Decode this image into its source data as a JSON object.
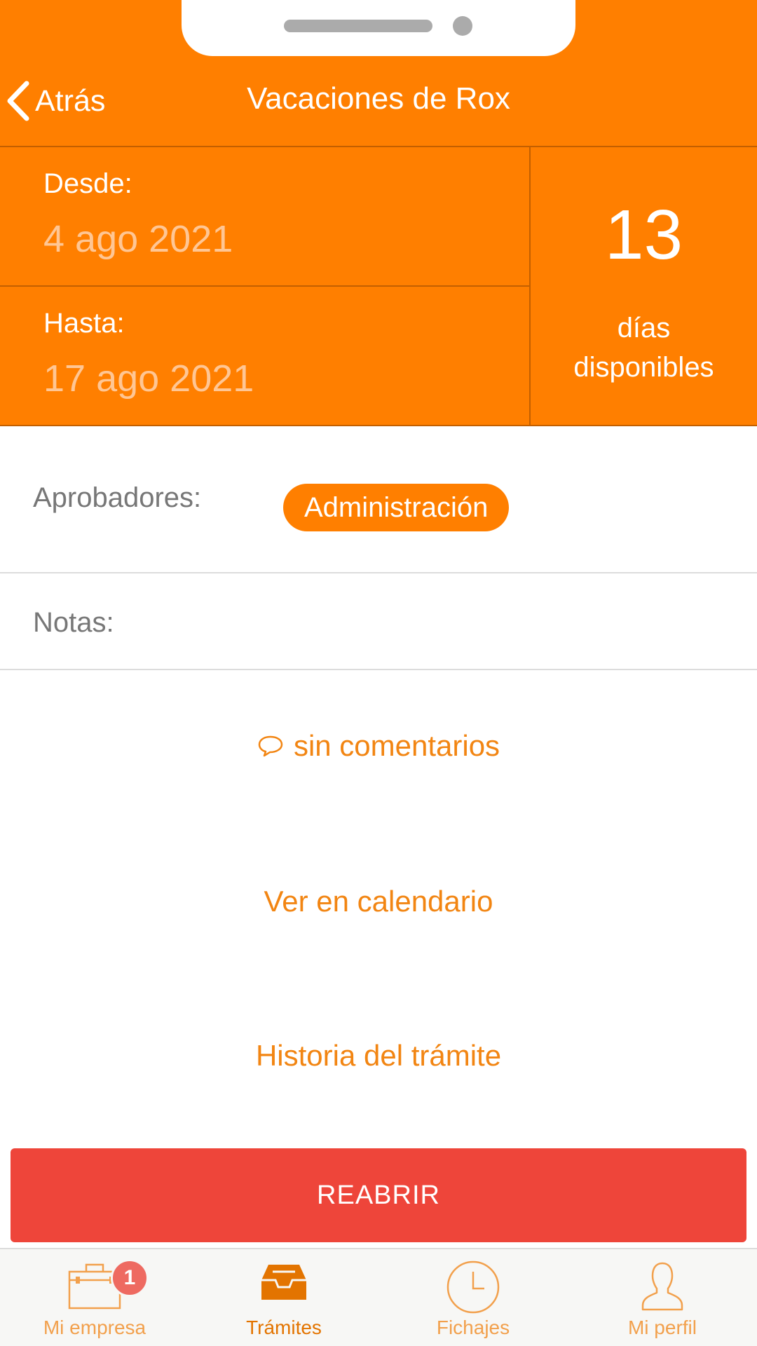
{
  "header": {
    "back_label": "Atrás",
    "title": "Vacaciones de Rox",
    "background_color": "#FF7F00"
  },
  "dates": {
    "from_label": "Desde:",
    "from_value": "4 ago 2021",
    "to_label": "Hasta:",
    "to_value": "17 ago 2021",
    "days_number": "13",
    "days_label_line1": "días",
    "days_label_line2": "disponibles"
  },
  "approvers": {
    "label": "Aprobadores:",
    "chip": "Administración"
  },
  "notes": {
    "label": "Notas:"
  },
  "links": {
    "comments": "sin comentarios",
    "calendar": "Ver en calendario",
    "history": "Historia del trámite"
  },
  "reopen_button": "REABRIR",
  "tabbar": {
    "items": [
      {
        "label": "Mi empresa",
        "icon": "briefcase-icon",
        "badge": "1"
      },
      {
        "label": "Trámites",
        "icon": "inbox-tray-icon",
        "active": true
      },
      {
        "label": "Fichajes",
        "icon": "clock-icon"
      },
      {
        "label": "Mi perfil",
        "icon": "user-icon"
      }
    ]
  },
  "colors": {
    "accent": "#FF7F00",
    "link": "#F28512",
    "danger": "#EE453A",
    "badge": "#EE6A61"
  }
}
